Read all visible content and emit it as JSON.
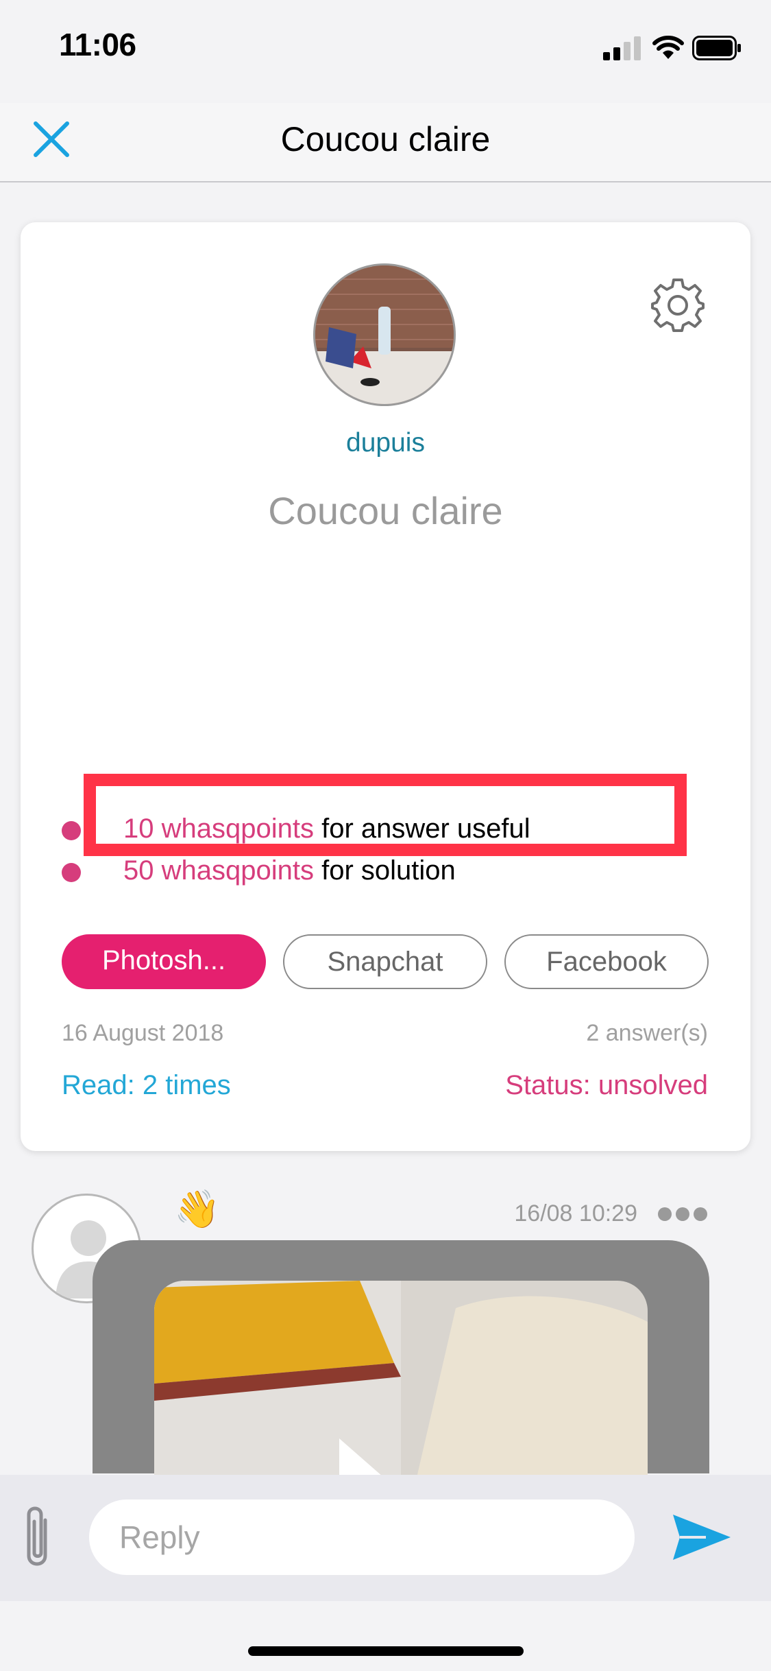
{
  "status_bar": {
    "time": "11:06"
  },
  "nav": {
    "title": "Coucou claire"
  },
  "card": {
    "username": "dupuis",
    "title": "Coucou claire",
    "rewards": [
      {
        "points": "10 whasqpoints",
        "label": " for answer useful"
      },
      {
        "points": "50 whasqpoints",
        "label": " for solution"
      }
    ],
    "tags": [
      "Photosh...",
      "Snapchat",
      "Facebook"
    ],
    "date": "16 August 2018",
    "answers": "2 answer(s)",
    "read": "Read: 2 times",
    "status": "Status: unsolved"
  },
  "answer": {
    "emoji": "👋",
    "time": "16/08 10:29"
  },
  "reply": {
    "placeholder": "Reply"
  },
  "colors": {
    "accent_pink": "#e5206f",
    "link_blue": "#23a7d6",
    "username_teal": "#1b7f9a",
    "send_blue": "#1aa3e0",
    "highlight_red": "#ff3347"
  }
}
